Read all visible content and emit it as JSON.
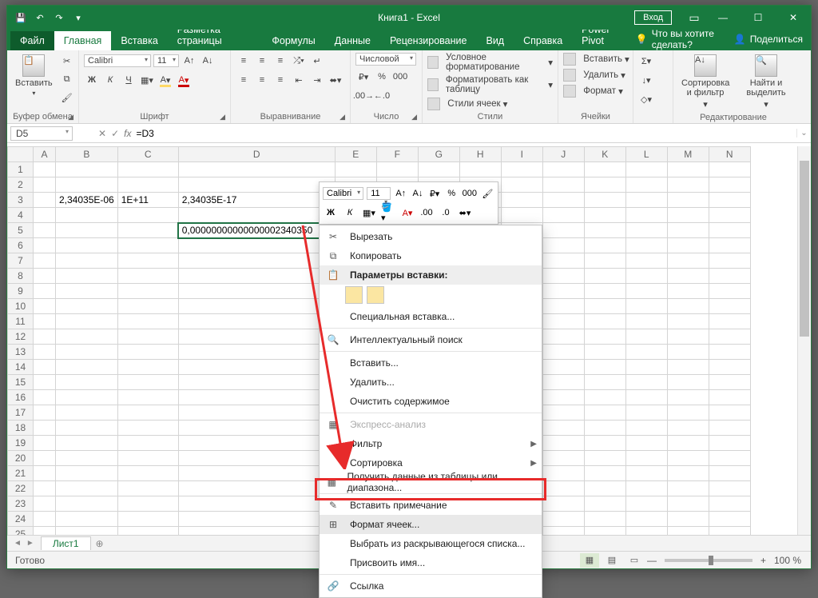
{
  "window": {
    "title": "Книга1 - Excel",
    "login": "Вход"
  },
  "tabs": {
    "file": "Файл",
    "items": [
      "Главная",
      "Вставка",
      "Разметка страницы",
      "Формулы",
      "Данные",
      "Рецензирование",
      "Вид",
      "Справка",
      "Power Pivot"
    ],
    "active_index": 0,
    "tell_me": "Что вы хотите сделать?",
    "share": "Поделиться"
  },
  "ribbon": {
    "clipboard": {
      "paste": "Вставить",
      "group": "Буфер обмена"
    },
    "font": {
      "name": "Calibri",
      "size": "11",
      "bold": "Ж",
      "italic": "К",
      "underline": "Ч",
      "group": "Шрифт"
    },
    "alignment": {
      "group": "Выравнивание"
    },
    "number": {
      "format": "Числовой",
      "group": "Число"
    },
    "styles": {
      "cond": "Условное форматирование",
      "table": "Форматировать как таблицу",
      "cell": "Стили ячеек",
      "group": "Стили"
    },
    "cells": {
      "insert": "Вставить",
      "delete": "Удалить",
      "format": "Формат",
      "group": "Ячейки"
    },
    "editing": {
      "sort": "Сортировка и фильтр",
      "find": "Найти и выделить",
      "group": "Редактирование"
    }
  },
  "formula_bar": {
    "name_box": "D5",
    "formula": "=D3"
  },
  "sheet": {
    "columns": [
      "A",
      "B",
      "C",
      "D",
      "E",
      "F",
      "G",
      "H",
      "I",
      "J",
      "K",
      "L",
      "M",
      "N"
    ],
    "row_count": 25,
    "cells": {
      "B3": "2,34035E-06",
      "C3": "1E+11",
      "D3": "2,34035E-17",
      "D5": "0,00000000000000002340350"
    },
    "selected": "D5",
    "tab": "Лист1"
  },
  "minibar": {
    "font": "Calibri",
    "size": "11",
    "bold": "Ж",
    "italic": "К"
  },
  "context_menu": {
    "cut": "Вырезать",
    "copy": "Копировать",
    "paste_header": "Параметры вставки:",
    "paste_special": "Специальная вставка...",
    "smart_lookup": "Интеллектуальный поиск",
    "insert": "Вставить...",
    "delete": "Удалить...",
    "clear": "Очистить содержимое",
    "quick": "Экспресс-анализ",
    "filter": "Фильтр",
    "sort": "Сортировка",
    "get_data": "Получить данные из таблицы или диапазона...",
    "comment": "Вставить примечание",
    "format_cells": "Формат ячеек...",
    "dropdown": "Выбрать из раскрывающегося списка...",
    "define_name": "Присвоить имя...",
    "link": "Ссылка"
  },
  "status": {
    "ready": "Готово",
    "zoom": "100 %"
  }
}
